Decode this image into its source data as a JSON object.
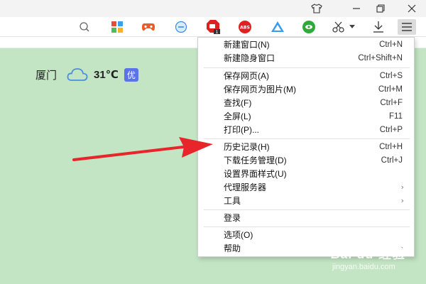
{
  "toolbar": {
    "icons": [
      "tshirt-icon",
      "minimize-icon",
      "restore-icon",
      "close-icon",
      "search-icon",
      "apps-icon",
      "game-icon",
      "minus-circle-icon",
      "adblock-stop-icon",
      "abs-icon",
      "drive-icon",
      "green-plugin-icon",
      "scissors-icon",
      "download-icon",
      "menu-icon"
    ],
    "abs_label": "ABS",
    "badge": "1"
  },
  "weather": {
    "city": "厦门",
    "temperature": "31℃",
    "aqi": "优",
    "icon": "cloud-icon"
  },
  "menu": {
    "items": [
      {
        "label": "新建窗口(N)",
        "shortcut": "Ctrl+N"
      },
      {
        "label": "新建隐身窗口",
        "shortcut": "Ctrl+Shift+N"
      },
      {
        "label": "保存网页(A)",
        "shortcut": "Ctrl+S"
      },
      {
        "label": "保存网页为图片(M)",
        "shortcut": "Ctrl+M"
      },
      {
        "label": "查找(F)",
        "shortcut": "Ctrl+F"
      },
      {
        "label": "全屏(L)",
        "shortcut": "F11"
      },
      {
        "label": "打印(P)...",
        "shortcut": "Ctrl+P"
      },
      {
        "label": "历史记录(H)",
        "shortcut": "Ctrl+H"
      },
      {
        "label": "下载任务管理(D)",
        "shortcut": "Ctrl+J"
      },
      {
        "label": "设置界面样式(U)",
        "shortcut": ""
      },
      {
        "label": "代理服务器",
        "shortcut": ""
      },
      {
        "label": "工具",
        "shortcut": ""
      },
      {
        "label": "登录",
        "shortcut": ""
      },
      {
        "label": "选项(O)",
        "shortcut": ""
      },
      {
        "label": "帮助",
        "shortcut": ""
      }
    ],
    "submenu_arrow": "›"
  },
  "annotation": {
    "arrow_color": "#e8252b",
    "points_to": "历史记录(H)"
  },
  "watermark": {
    "text": "Bai du 经验",
    "url": "jingyan.baidu.com"
  },
  "colors": {
    "content_bg": "#c3e5c4",
    "aqi_bg": "#5a73e8",
    "arrow": "#e8252b"
  }
}
